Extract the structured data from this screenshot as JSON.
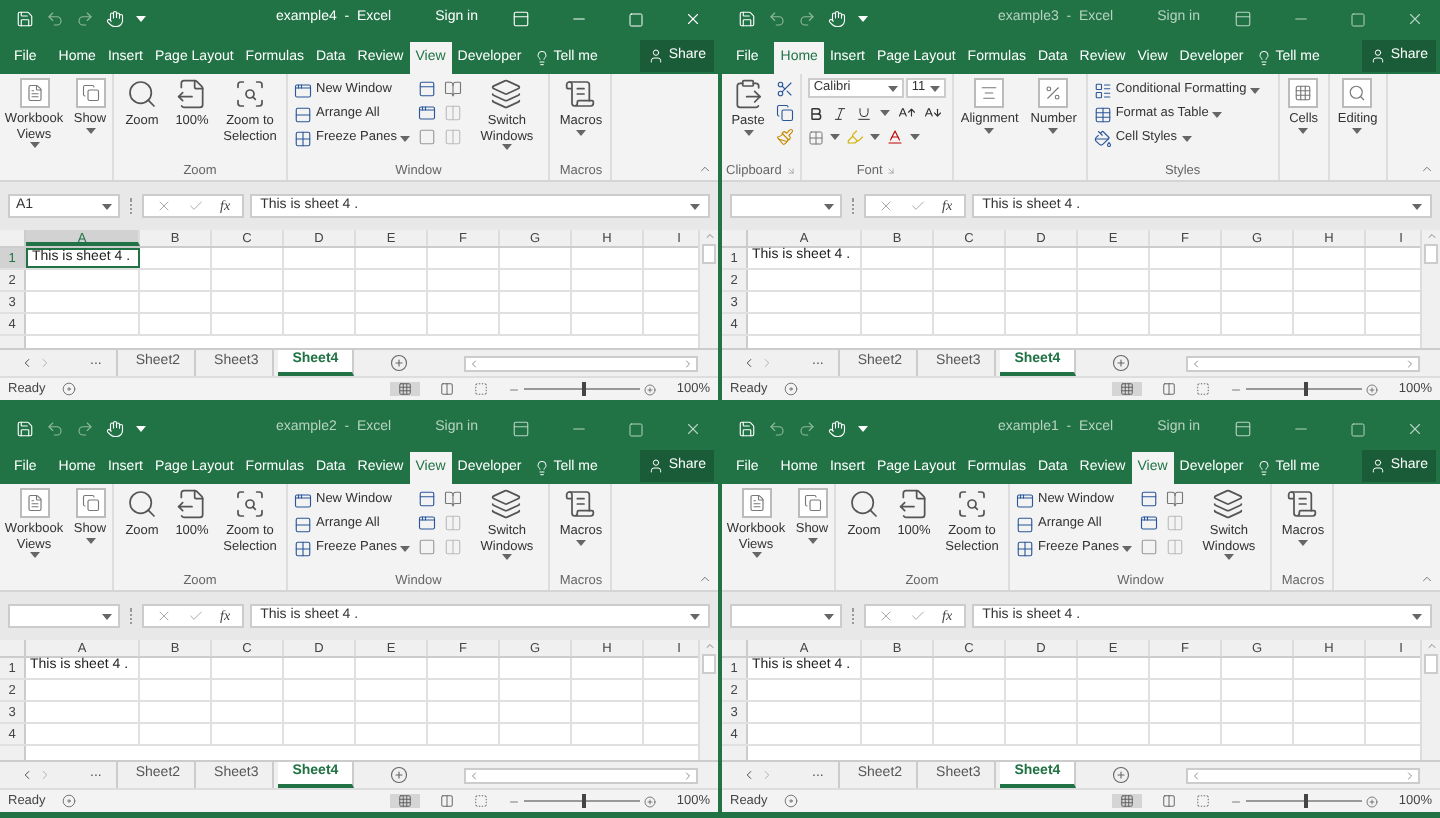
{
  "windows": [
    {
      "title": "example4  -  Excel",
      "active": true,
      "sign_in": "Sign in",
      "tabs": [
        {
          "label": "File",
          "selected": false
        },
        {
          "label": "Home",
          "selected": false
        },
        {
          "label": "Insert",
          "selected": false
        },
        {
          "label": "Page Layout",
          "selected": false
        },
        {
          "label": "Formulas",
          "selected": false
        },
        {
          "label": "Data",
          "selected": false
        },
        {
          "label": "Review",
          "selected": false
        },
        {
          "label": "View",
          "selected": true
        },
        {
          "label": "Developer",
          "selected": false
        }
      ],
      "tell_me": "Tell me",
      "share": "Share",
      "ribbon": {
        "kind": "view",
        "workbook_views": "Workbook Views",
        "show": "Show",
        "zoom": [
          "Zoom",
          "100%",
          "Zoom to Selection"
        ],
        "zoom_label": "Zoom",
        "window": [
          "New Window",
          "Arrange All",
          "Freeze Panes"
        ],
        "switch_windows": "Switch Windows",
        "window_label": "Window",
        "macros": "Macros",
        "macros_label": "Macros"
      },
      "name_box": "A1",
      "function_label": "fx",
      "formula": "This is sheet 4 .",
      "columns": [
        "A",
        "B",
        "C",
        "D",
        "E",
        "F",
        "G",
        "H",
        "I"
      ],
      "rows": [
        "1",
        "2",
        "3",
        "4"
      ],
      "cell": {
        "text": "This is sheet 4 .",
        "selected": true
      },
      "sheet_tabs": [
        {
          "label": "...",
          "selected": false
        },
        {
          "label": "Sheet2",
          "selected": false
        },
        {
          "label": "Sheet3",
          "selected": false
        },
        {
          "label": "Sheet4",
          "selected": true
        }
      ],
      "status": {
        "ready": "Ready",
        "level": 0.5,
        "zoom": "100%"
      }
    },
    {
      "title": "example3  -  Excel",
      "active": false,
      "sign_in": "Sign in",
      "tabs": [
        {
          "label": "File",
          "selected": false
        },
        {
          "label": "Home",
          "selected": true
        },
        {
          "label": "Insert",
          "selected": false
        },
        {
          "label": "Page Layout",
          "selected": false
        },
        {
          "label": "Formulas",
          "selected": false
        },
        {
          "label": "Data",
          "selected": false
        },
        {
          "label": "Review",
          "selected": false
        },
        {
          "label": "View",
          "selected": false
        },
        {
          "label": "Developer",
          "selected": false
        }
      ],
      "tell_me": "Tell me",
      "share": "Share",
      "ribbon": {
        "kind": "home",
        "paste": "Paste",
        "clipboard_label": "Clipboard",
        "font_name": "Calibri",
        "font_size": "11",
        "font_label": "Font",
        "alignment": "Alignment",
        "number": "Number",
        "styles": [
          "Conditional Formatting",
          "Format as Table",
          "Cell Styles"
        ],
        "styles_label": "Styles",
        "cells": "Cells",
        "editing": "Editing"
      },
      "function_label": "fx",
      "formula": "This is sheet 4 .",
      "columns": [
        "A",
        "B",
        "C",
        "D",
        "E",
        "F",
        "G",
        "H",
        "I"
      ],
      "rows": [
        "1",
        "2",
        "3",
        "4"
      ],
      "cell": {
        "text": "This is sheet 4 .",
        "selected": false
      },
      "sheet_tabs": [
        {
          "label": "...",
          "selected": false
        },
        {
          "label": "Sheet2",
          "selected": false
        },
        {
          "label": "Sheet3",
          "selected": false
        },
        {
          "label": "Sheet4",
          "selected": true
        }
      ],
      "status": {
        "ready": "Ready",
        "level": 0.5,
        "zoom": "100%"
      }
    },
    {
      "title": "example2  -  Excel",
      "active": false,
      "sign_in": "Sign in",
      "tabs": [
        {
          "label": "File",
          "selected": false
        },
        {
          "label": "Home",
          "selected": false
        },
        {
          "label": "Insert",
          "selected": false
        },
        {
          "label": "Page Layout",
          "selected": false
        },
        {
          "label": "Formulas",
          "selected": false
        },
        {
          "label": "Data",
          "selected": false
        },
        {
          "label": "Review",
          "selected": false
        },
        {
          "label": "View",
          "selected": true
        },
        {
          "label": "Developer",
          "selected": false
        }
      ],
      "tell_me": "Tell me",
      "share": "Share",
      "ribbon": {
        "kind": "view",
        "workbook_views": "Workbook Views",
        "show": "Show",
        "zoom": [
          "Zoom",
          "100%",
          "Zoom to Selection"
        ],
        "zoom_label": "Zoom",
        "window": [
          "New Window",
          "Arrange All",
          "Freeze Panes"
        ],
        "switch_windows": "Switch Windows",
        "window_label": "Window",
        "macros": "Macros",
        "macros_label": "Macros"
      },
      "function_label": "fx",
      "formula": "This is sheet 4 .",
      "columns": [
        "A",
        "B",
        "C",
        "D",
        "E",
        "F",
        "G",
        "H",
        "I"
      ],
      "rows": [
        "1",
        "2",
        "3",
        "4"
      ],
      "cell": {
        "text": "This is sheet 4 .",
        "selected": false
      },
      "sheet_tabs": [
        {
          "label": "...",
          "selected": false
        },
        {
          "label": "Sheet2",
          "selected": false
        },
        {
          "label": "Sheet3",
          "selected": false
        },
        {
          "label": "Sheet4",
          "selected": true
        }
      ],
      "status": {
        "ready": "Ready",
        "level": 0.5,
        "zoom": "100%"
      }
    },
    {
      "title": "example1  -  Excel",
      "active": false,
      "sign_in": "Sign in",
      "tabs": [
        {
          "label": "File",
          "selected": false
        },
        {
          "label": "Home",
          "selected": false
        },
        {
          "label": "Insert",
          "selected": false
        },
        {
          "label": "Page Layout",
          "selected": false
        },
        {
          "label": "Formulas",
          "selected": false
        },
        {
          "label": "Data",
          "selected": false
        },
        {
          "label": "Review",
          "selected": false
        },
        {
          "label": "View",
          "selected": true
        },
        {
          "label": "Developer",
          "selected": false
        }
      ],
      "tell_me": "Tell me",
      "share": "Share",
      "ribbon": {
        "kind": "view",
        "workbook_views": "Workbook Views",
        "show": "Show",
        "zoom": [
          "Zoom",
          "100%",
          "Zoom to Selection"
        ],
        "zoom_label": "Zoom",
        "window": [
          "New Window",
          "Arrange All",
          "Freeze Panes"
        ],
        "switch_windows": "Switch Windows",
        "window_label": "Window",
        "macros": "Macros",
        "macros_label": "Macros"
      },
      "function_label": "fx",
      "formula": "This is sheet 4 .",
      "columns": [
        "A",
        "B",
        "C",
        "D",
        "E",
        "F",
        "G",
        "H",
        "I"
      ],
      "rows": [
        "1",
        "2",
        "3",
        "4"
      ],
      "cell": {
        "text": "This is sheet 4 .",
        "selected": false
      },
      "sheet_tabs": [
        {
          "label": "...",
          "selected": false
        },
        {
          "label": "Sheet2",
          "selected": false
        },
        {
          "label": "Sheet3",
          "selected": false
        },
        {
          "label": "Sheet4",
          "selected": true
        }
      ],
      "status": {
        "ready": "Ready",
        "level": 0.5,
        "zoom": "100%"
      }
    }
  ]
}
